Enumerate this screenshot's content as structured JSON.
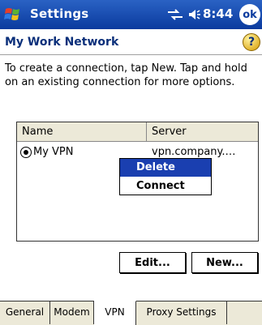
{
  "titlebar": {
    "app_title": "Settings",
    "clock": "8:44",
    "ok_label": "ok"
  },
  "header": {
    "page_title": "My Work Network",
    "help_glyph": "?"
  },
  "instructions": "To create a connection, tap New. Tap and hold on an existing connection for more options.",
  "list": {
    "columns": [
      "Name",
      "Server"
    ],
    "rows": [
      {
        "name": "My VPN",
        "server": "vpn.company.…",
        "selected": true
      }
    ]
  },
  "context_menu": {
    "items": [
      {
        "label": "Delete",
        "highlighted": true
      },
      {
        "label": "Connect",
        "highlighted": false
      }
    ]
  },
  "buttons": {
    "edit": "Edit...",
    "new": "New..."
  },
  "tabs": [
    {
      "label": "General",
      "active": false
    },
    {
      "label": "Modem",
      "active": false
    },
    {
      "label": "VPN",
      "active": true
    },
    {
      "label": "Proxy Settings",
      "active": false
    }
  ],
  "colors": {
    "titlebar": "#0a3a9e",
    "menu_highlight": "#1a3fb0"
  },
  "icons": [
    "windows-start-icon",
    "connectivity-icon",
    "volume-icon",
    "help-icon"
  ]
}
